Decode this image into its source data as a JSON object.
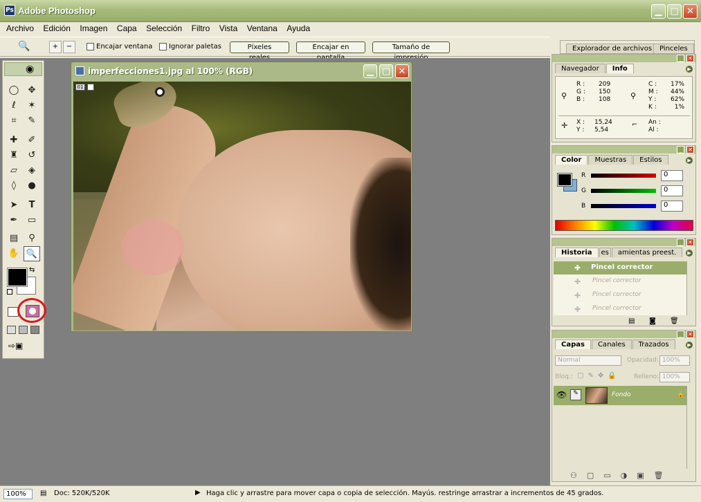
{
  "window": {
    "title": "Adobe Photoshop",
    "logo_text": "Ps",
    "minimize": "▁",
    "maximize": "□",
    "close": "✕"
  },
  "menu": [
    "Archivo",
    "Edición",
    "Imagen",
    "Capa",
    "Selección",
    "Filtro",
    "Vista",
    "Ventana",
    "Ayuda"
  ],
  "options": {
    "fit_window": "Encajar ventana",
    "ignore_palettes": "Ignorar paletas",
    "actual_pixels": "Píxeles reales",
    "fit_screen": "Encajar en pantalla",
    "print_size": "Tamaño de impresión",
    "zoom_in": "+",
    "zoom_out": "−"
  },
  "top_right_tabs": {
    "file_browser": "Explorador de archivos",
    "brushes": "Pinceles"
  },
  "document": {
    "title": "imperfecciones1.jpg al 100% (RGB)",
    "badge": "01"
  },
  "info_panel": {
    "tabs": [
      "Navegador",
      "Info"
    ],
    "rgb": {
      "R_label": "R :",
      "R": "209",
      "G_label": "G :",
      "G": "150",
      "B_label": "B :",
      "B": "108"
    },
    "cmyk": {
      "C_label": "C :",
      "C": "17%",
      "M_label": "M :",
      "M": "44%",
      "Y_label": "Y :",
      "Y": "62%",
      "K_label": "K :",
      "K": "1%"
    },
    "xy": {
      "X_label": "X :",
      "X": "15,24",
      "Y_label": "Y :",
      "Y": "5,54"
    },
    "size": {
      "An": "An :",
      "Al": "Al :"
    }
  },
  "color_panel": {
    "tabs": [
      "Color",
      "Muestras",
      "Estilos"
    ],
    "R_label": "R",
    "R": "0",
    "G_label": "G",
    "G": "0",
    "B_label": "B",
    "B": "0"
  },
  "history_panel": {
    "tabs": [
      "Historia",
      "es",
      "amientas preest."
    ],
    "items": [
      "Pincel corrector",
      "Pincel corrector",
      "Pincel corrector",
      "Pincel corrector"
    ]
  },
  "layers_panel": {
    "tabs": [
      "Capas",
      "Canales",
      "Trazados"
    ],
    "blend_mode": "Normal",
    "opacity_label": "Opacidad:",
    "opacity": "100%",
    "lock_label": "Bloq.:",
    "fill_label": "Relleno:",
    "fill": "100%",
    "layer_name": "Fondo"
  },
  "status": {
    "zoom": "100%",
    "doc": "Doc: 520K/520K",
    "hint": "Haga clic y arrastre para mover capa o copia de selección. Mayús. restringe arrastrar a incrementos de 45 grados."
  },
  "colors": {
    "accent": "#aab987",
    "workspace": "#7f7f7f",
    "highlight_circle": "#e0141e",
    "bg_swatch": "#7fb0d6"
  }
}
